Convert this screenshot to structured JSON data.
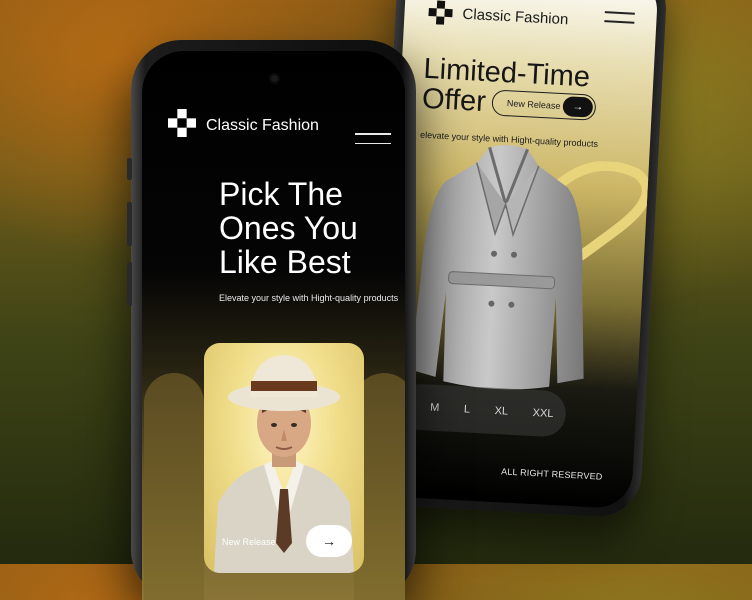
{
  "back_phone": {
    "brand_name": "Classic Fashion",
    "title": "Limited-Time Offer",
    "title_line1": "Limited-Time",
    "title_line2": "Offer",
    "release_label": "New Release",
    "subtitle": "elevate your style with Hight-quality products",
    "sizes": [
      "M",
      "L",
      "XL",
      "XXL"
    ],
    "footer": "ALL RIGHT RESERVED"
  },
  "front_phone": {
    "brand_name": "Classic Fashion",
    "title_line1": "Pick The",
    "title_line2": "Ones You",
    "title_line3": "Like Best",
    "subtitle": "Elevate your style with Hight-quality products",
    "release_label": "New Release"
  },
  "icons": {
    "logo": "checker-logo-icon",
    "menu": "hamburger-menu-icon",
    "arrow": "arrow-right-icon"
  },
  "colors": {
    "accent_gold": "#d9c064",
    "dark": "#0d0d0d",
    "light_text": "#ffffff"
  }
}
